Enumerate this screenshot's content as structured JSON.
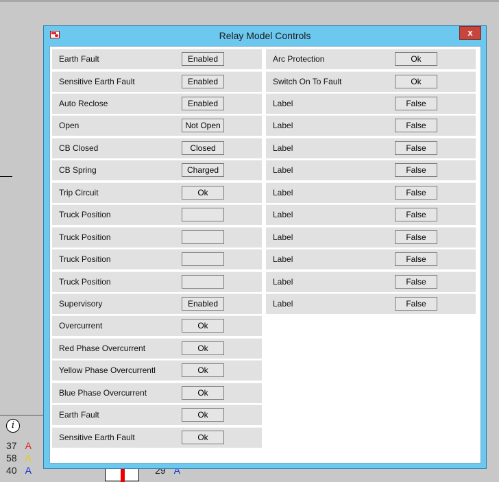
{
  "dialog": {
    "title": "Relay Model Controls",
    "close_label": "x",
    "icon": "relay-app-icon"
  },
  "left_rows": [
    {
      "label": "Earth Fault",
      "value": "Enabled"
    },
    {
      "label": "Sensitive Earth Fault",
      "value": "Enabled"
    },
    {
      "label": "Auto Reclose",
      "value": "Enabled"
    },
    {
      "label": "Open",
      "value": "Not Open"
    },
    {
      "label": "CB Closed",
      "value": "Closed"
    },
    {
      "label": "CB Spring",
      "value": "Charged"
    },
    {
      "label": "Trip Circuit",
      "value": "Ok"
    },
    {
      "label": "Truck Position",
      "value": ""
    },
    {
      "label": "Truck Position",
      "value": ""
    },
    {
      "label": "Truck Position",
      "value": ""
    },
    {
      "label": "Truck Position",
      "value": ""
    },
    {
      "label": "Supervisory",
      "value": "Enabled"
    },
    {
      "label": "Overcurrent",
      "value": "Ok"
    },
    {
      "label": "Red Phase Overcurrent",
      "value": "Ok"
    },
    {
      "label": "Yellow Phase Overcurrentl",
      "value": "Ok"
    },
    {
      "label": "Blue Phase Overcurrent",
      "value": "Ok"
    },
    {
      "label": "Earth Fault",
      "value": "Ok"
    },
    {
      "label": "Sensitive Earth Fault",
      "value": "Ok"
    }
  ],
  "right_rows": [
    {
      "label": "Arc Protection",
      "value": "Ok"
    },
    {
      "label": "Switch On To Fault",
      "value": "Ok"
    },
    {
      "label": "Label",
      "value": "False"
    },
    {
      "label": "Label",
      "value": "False"
    },
    {
      "label": "Label",
      "value": "False"
    },
    {
      "label": "Label",
      "value": "False"
    },
    {
      "label": "Label",
      "value": "False"
    },
    {
      "label": "Label",
      "value": "False"
    },
    {
      "label": "Label",
      "value": "False"
    },
    {
      "label": "Label",
      "value": "False"
    },
    {
      "label": "Label",
      "value": "False"
    },
    {
      "label": "Label",
      "value": "False"
    }
  ],
  "background": {
    "info_icon": "i",
    "readings": [
      {
        "value": "37",
        "unit": "A",
        "unit_color": "#e02020"
      },
      {
        "value": "58",
        "unit": "A",
        "unit_color": "#e0d000"
      },
      {
        "value": "40",
        "unit": "A",
        "unit_color": "#1030d0"
      },
      {
        "value": "29",
        "unit": "A",
        "unit_color": "#1030d0"
      }
    ]
  },
  "colors": {
    "titlebar": "#6cc8ef",
    "close_button": "#c7453b",
    "row_background": "#e1e1e1"
  }
}
